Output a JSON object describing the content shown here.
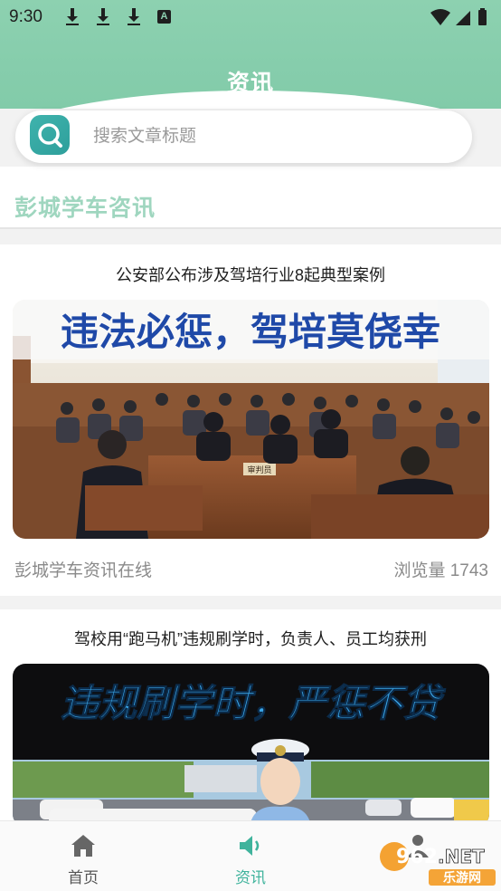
{
  "status_bar": {
    "time": "9:30",
    "a_badge": "A"
  },
  "header": {
    "title": "资讯"
  },
  "search": {
    "placeholder": "搜索文章标题"
  },
  "section": {
    "title": "彭城学车咨讯"
  },
  "articles": [
    {
      "title": "公安部公布涉及驾培行业8起典型案例",
      "banner_text": "违法必惩，驾培莫侥幸",
      "desk_sign": "审判员",
      "source": "彭城学车资讯在线",
      "views": "浏览量 1743"
    },
    {
      "title": "驾校用“跑马机”违规刷学时，负责人、员工均获刑",
      "banner_text": "违规刷学时，严惩不贷"
    }
  ],
  "tabbar": {
    "tabs": [
      {
        "label": "首页",
        "icon": "home-icon"
      },
      {
        "label": "资讯",
        "icon": "speaker-icon"
      },
      {
        "label": "",
        "icon": "user-icon"
      }
    ]
  },
  "watermark": {
    "brand": "962",
    "net": ".NET",
    "site": "乐游网"
  },
  "colors": {
    "accent": "#3fb39c",
    "header": "#8dd1b0",
    "section_title": "#9fd6bf"
  }
}
